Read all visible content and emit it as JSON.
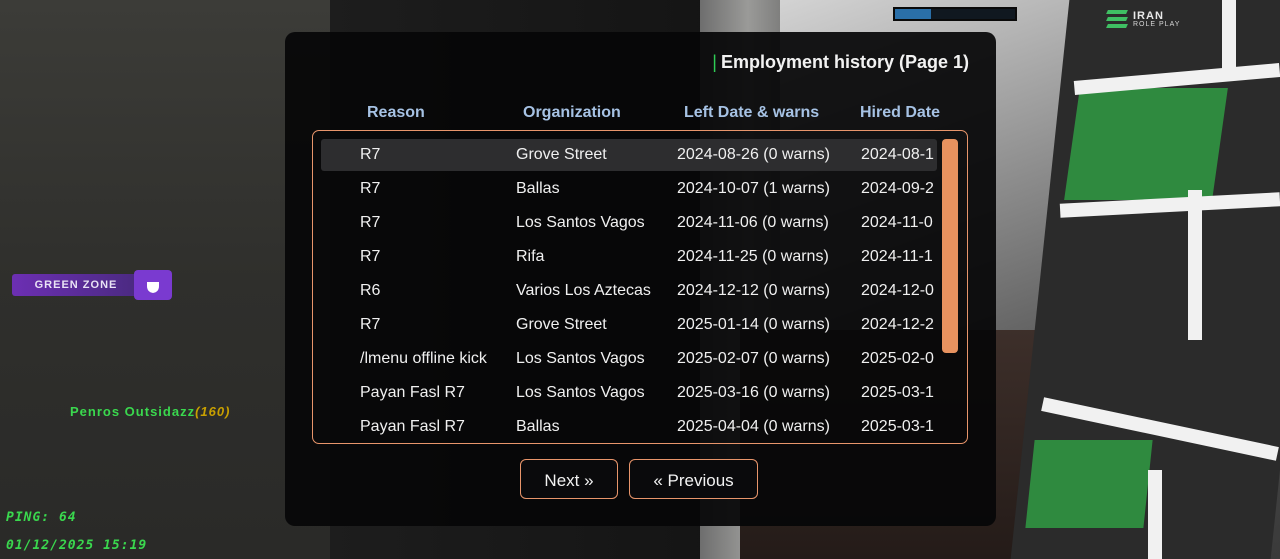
{
  "hud": {
    "progress": 0.3,
    "logo_name": "IRAN",
    "logo_sub": "ROLE PLAY",
    "zone_label": "GREEN ZONE",
    "player_name": "Penros Outsidazz",
    "player_id": "(160)",
    "ping": "PING: 64",
    "datetime": "01/12/2025 15:19"
  },
  "dialog": {
    "title": "Employment history (Page 1)",
    "columns": [
      "Reason",
      "Organization",
      "Left Date & warns",
      "Hired Date"
    ],
    "rows": [
      {
        "reason": "R7",
        "organization": "Grove Street",
        "left": "2024-08-26 (0 warns)",
        "hired": "2024-08-1"
      },
      {
        "reason": "R7",
        "organization": "Ballas",
        "left": "2024-10-07 (1 warns)",
        "hired": "2024-09-2"
      },
      {
        "reason": "R7",
        "organization": "Los Santos Vagos",
        "left": "2024-11-06 (0 warns)",
        "hired": "2024-11-0"
      },
      {
        "reason": "R7",
        "organization": "Rifa",
        "left": "2024-11-25 (0 warns)",
        "hired": "2024-11-1"
      },
      {
        "reason": "R6",
        "organization": "Varios Los Aztecas",
        "left": "2024-12-12 (0 warns)",
        "hired": "2024-12-0"
      },
      {
        "reason": "R7",
        "organization": "Grove Street",
        "left": "2025-01-14 (0 warns)",
        "hired": "2024-12-2"
      },
      {
        "reason": "/lmenu offline kick",
        "organization": "Los Santos Vagos",
        "left": "2025-02-07 (0 warns)",
        "hired": "2025-02-0"
      },
      {
        "reason": "Payan Fasl R7",
        "organization": "Los Santos Vagos",
        "left": "2025-03-16 (0 warns)",
        "hired": "2025-03-1"
      },
      {
        "reason": "Payan Fasl R7",
        "organization": "Ballas",
        "left": "2025-04-04 (0 warns)",
        "hired": "2025-03-1"
      }
    ],
    "next_label": "Next »",
    "prev_label": "« Previous"
  },
  "colors": {
    "accent": "#e8956b",
    "header": "#a6c2e4",
    "hud_green": "#3ad84e",
    "zone_purple": "#7a3ad0"
  }
}
